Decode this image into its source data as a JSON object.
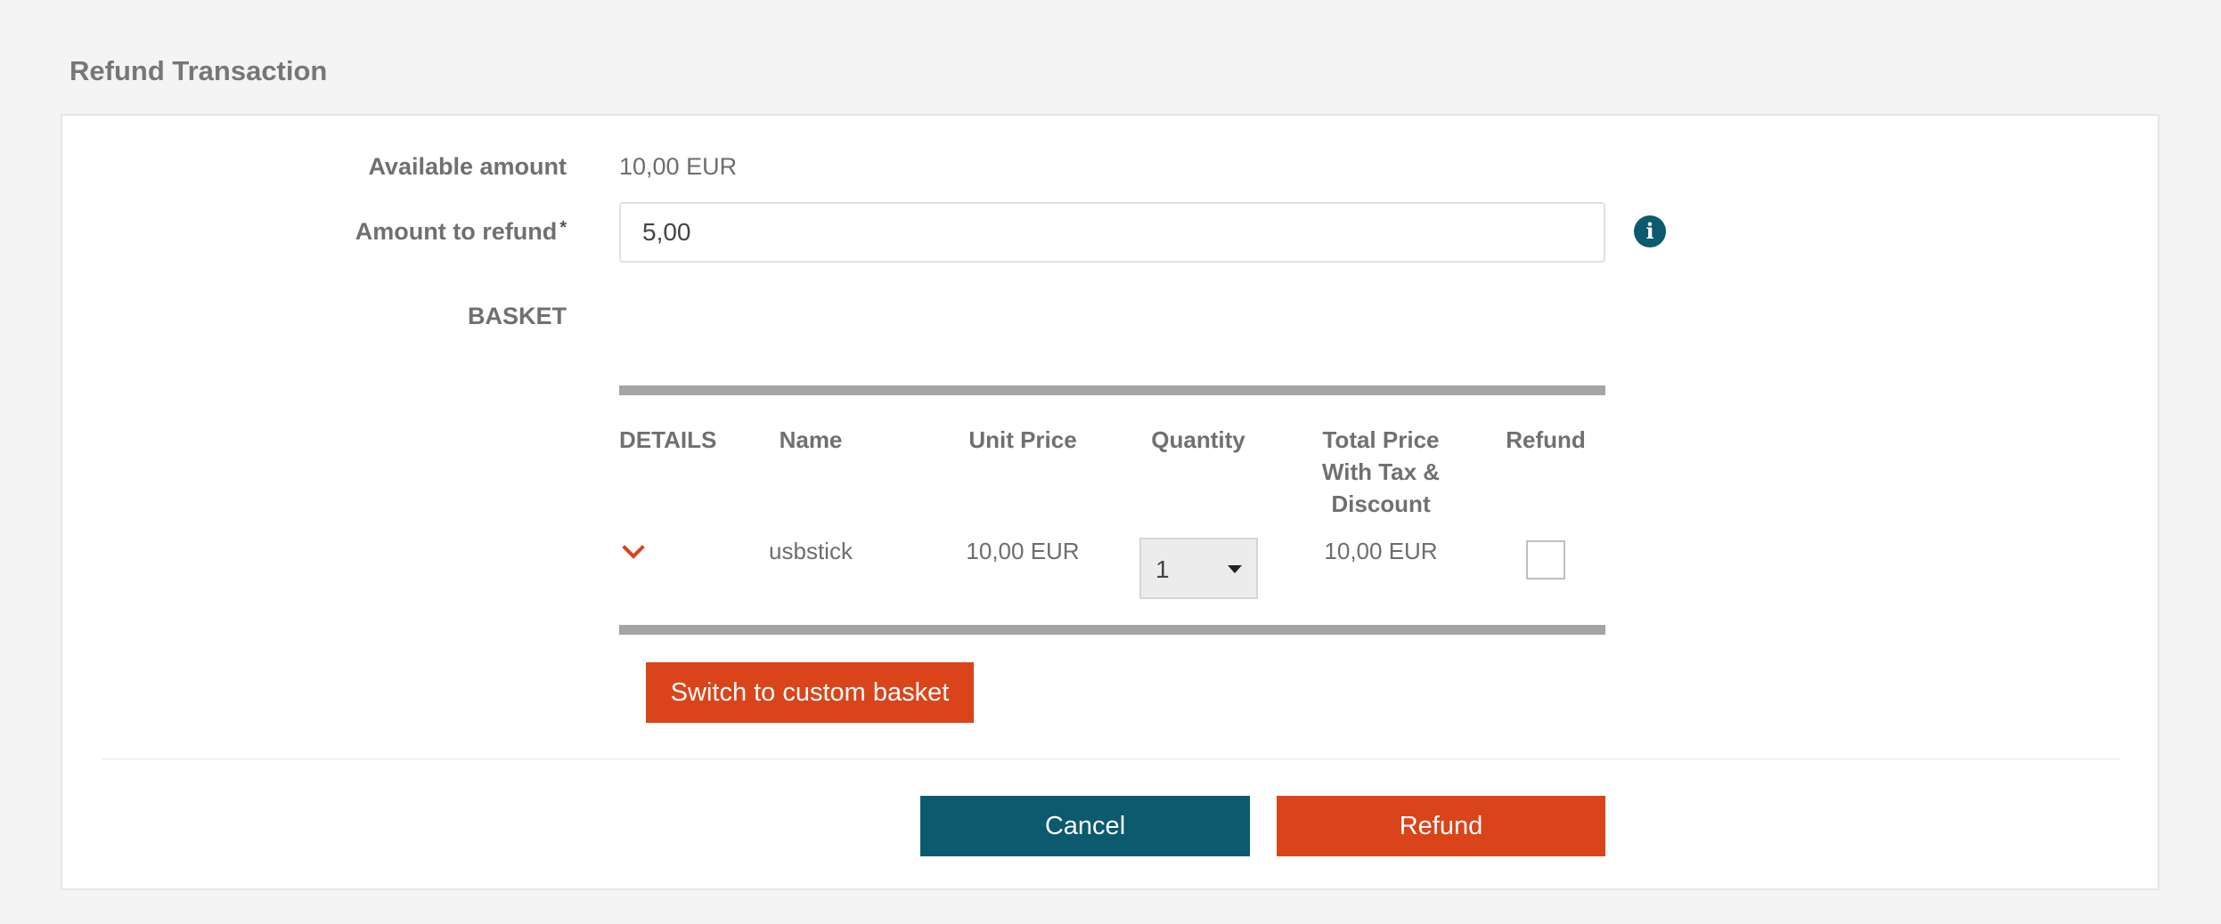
{
  "page": {
    "title": "Refund Transaction"
  },
  "form": {
    "available_amount_label": "Available amount",
    "available_amount_value": "10,00 EUR",
    "amount_to_refund_label": "Amount to refund",
    "required_marker": "*",
    "amount_to_refund_value": "5,00",
    "info_icon": "info-circle-icon",
    "basket_label": "BASKET"
  },
  "basket_table": {
    "columns": [
      "DETAILS",
      "Name",
      "Unit Price",
      "Quantity",
      "Total Price With Tax & Discount",
      "Refund"
    ],
    "rows": [
      {
        "details_icon": "chevron-down-icon",
        "name": "usbstick",
        "unit_price": "10,00 EUR",
        "quantity": "1",
        "total_price": "10,00 EUR",
        "refund_checked": false
      }
    ]
  },
  "actions": {
    "switch_basket_label": "Switch to custom basket",
    "cancel_label": "Cancel",
    "refund_label": "Refund"
  },
  "colors": {
    "accent_orange": "#da441a",
    "accent_teal": "#0b5a6e",
    "table_rule": "#a4a4a4"
  }
}
